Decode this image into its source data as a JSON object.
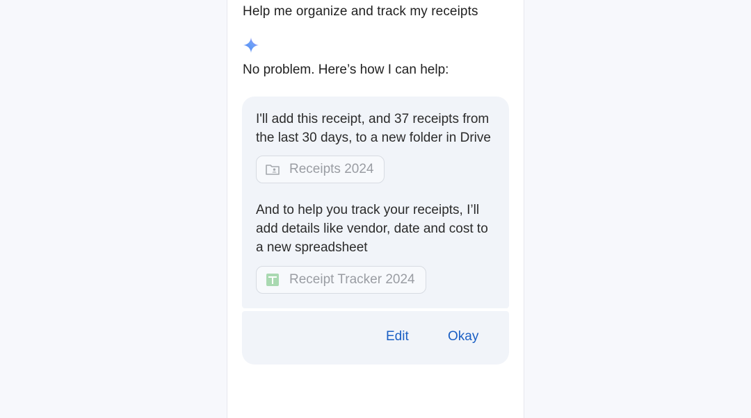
{
  "conversation": {
    "user_prompt": "Help me organize and track my receipts",
    "assistant_icon": "gemini-sparkle-icon",
    "assistant_intro": "No problem. Here’s how I can help:"
  },
  "plan_card": {
    "step1_text": "I'll add this receipt, and 37 receipts from the last 30 days, to a new folder in Drive",
    "folder_chip": {
      "label": "Receipts 2024",
      "icon": "shared-folder-icon"
    },
    "step2_text": "And to help you track your receipts, I’ll add details like vendor, date and cost to a new spreadsheet",
    "sheet_chip": {
      "label": "Receipt Tracker 2024",
      "icon": "sheets-icon"
    }
  },
  "actions": {
    "edit_label": "Edit",
    "okay_label": "Okay"
  },
  "colors": {
    "accent": "#1a5fc4",
    "card_background": "#f1f4f9",
    "sheets_green": "#9fd6a8"
  }
}
